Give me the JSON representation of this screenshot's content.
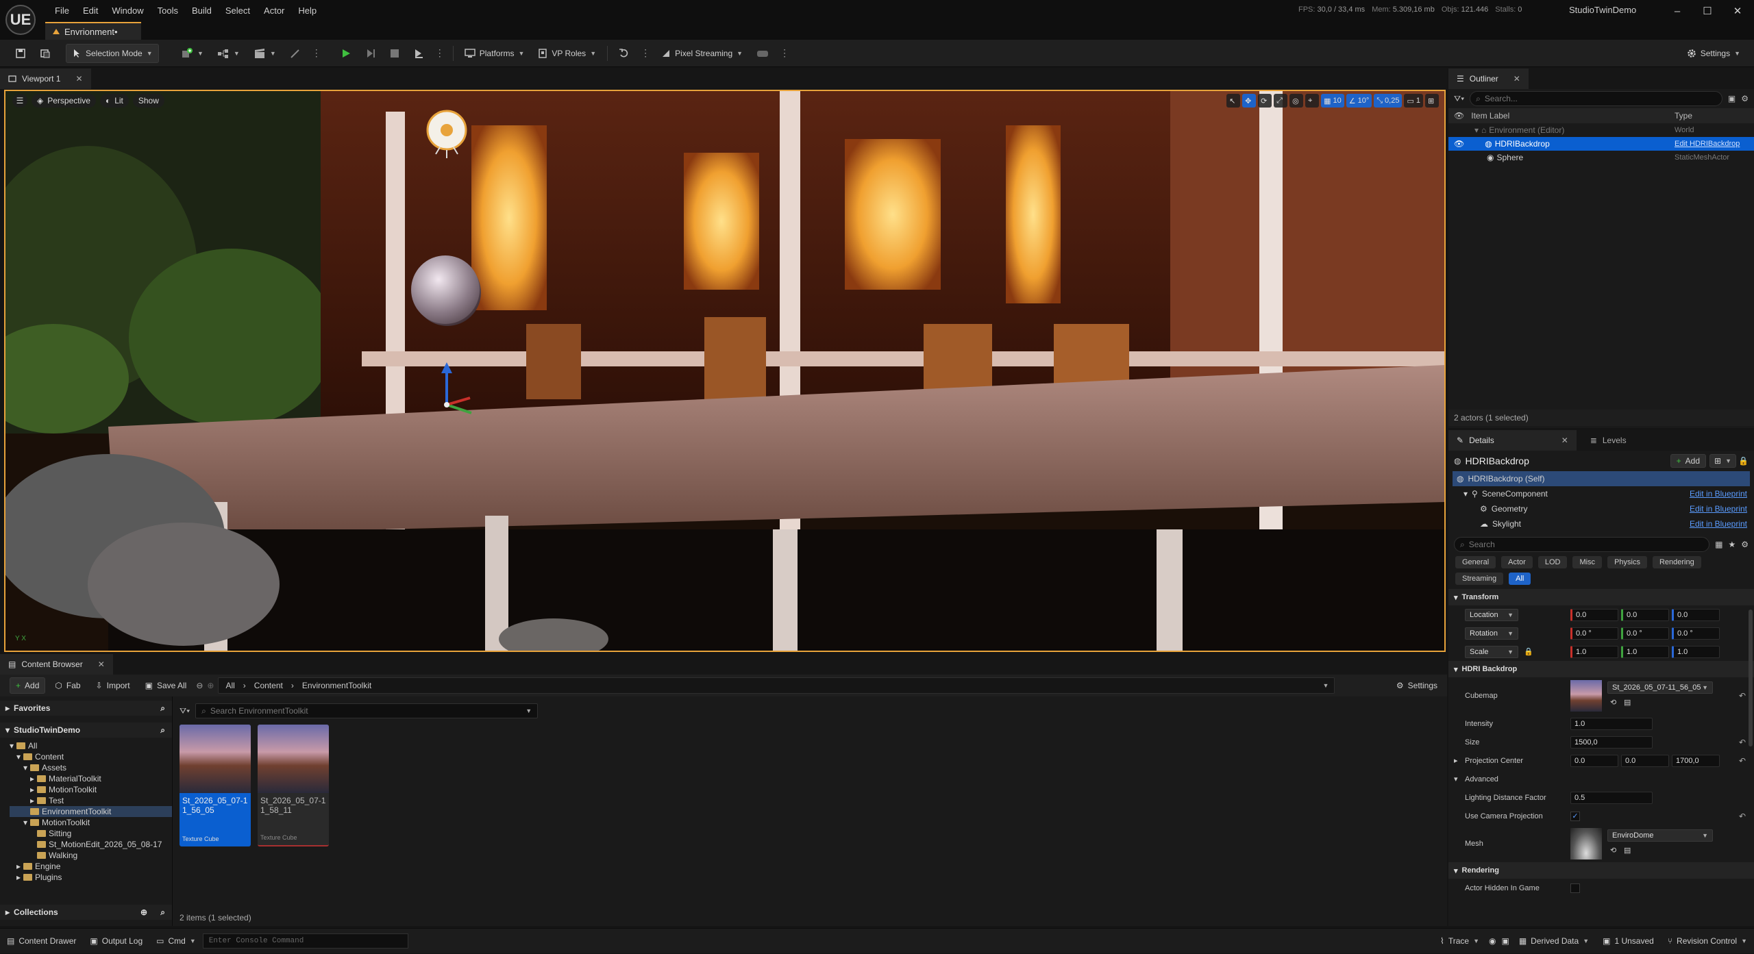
{
  "app": {
    "logo": "UE",
    "menu": [
      "File",
      "Edit",
      "Window",
      "Tools",
      "Build",
      "Select",
      "Actor",
      "Help"
    ],
    "level_tab": "Envrionment•",
    "stats": {
      "fps_label": "FPS:",
      "fps": "30,0",
      "ms": "/ 33,4 ms",
      "mem_label": "Mem:",
      "mem": "5.309,16 mb",
      "objs_label": "Objs:",
      "objs": "121.446",
      "stalls_label": "Stalls:",
      "stalls": "0"
    },
    "project_name": "StudioTwinDemo",
    "window_buttons": {
      "minimize": "–",
      "maximize": "☐",
      "close": "✕"
    }
  },
  "toolbar": {
    "selection_mode": "Selection Mode",
    "platforms": "Platforms",
    "vp_roles": "VP Roles",
    "pixel_streaming": "Pixel Streaming",
    "settings": "Settings"
  },
  "viewport": {
    "tab_label": "Viewport 1",
    "perspective": "Perspective",
    "lit": "Lit",
    "show": "Show",
    "grid_snap": "10",
    "rot_snap": "10°",
    "scale_snap": "0,25",
    "camera_speed": "1",
    "axis_label": "Y X"
  },
  "outliner": {
    "tab_label": "Outliner",
    "search_placeholder": "Search...",
    "col_label": "Item Label",
    "col_type": "Type",
    "rows": [
      {
        "label": "Environment (Editor)",
        "type": "World"
      },
      {
        "label": "HDRIBackdrop",
        "type": "Edit HDRIBackdrop"
      },
      {
        "label": "Sphere",
        "type": "StaticMeshActor"
      }
    ],
    "footer": "2 actors (1 selected)"
  },
  "details": {
    "tab_label": "Details",
    "levels_label": "Levels",
    "actor_name": "HDRIBackdrop",
    "add_label": "Add",
    "components": [
      {
        "label": "HDRIBackdrop (Self)",
        "link": ""
      },
      {
        "label": "SceneComponent",
        "link": "Edit in Blueprint"
      },
      {
        "label": "Geometry",
        "link": "Edit in Blueprint"
      },
      {
        "label": "Skylight",
        "link": "Edit in Blueprint"
      }
    ],
    "search_placeholder": "Search",
    "filters": [
      "General",
      "Actor",
      "LOD",
      "Misc",
      "Physics",
      "Rendering",
      "Streaming",
      "All"
    ],
    "transform": {
      "header": "Transform",
      "location_label": "Location",
      "location": [
        "0.0",
        "0.0",
        "0.0"
      ],
      "rotation_label": "Rotation",
      "rotation": [
        "0.0 °",
        "0.0 °",
        "0.0 °"
      ],
      "scale_label": "Scale",
      "scale": [
        "1.0",
        "1.0",
        "1.0"
      ]
    },
    "hdri": {
      "header": "HDRI Backdrop",
      "cubemap_label": "Cubemap",
      "cubemap_value": "St_2026_05_07-11_56_05",
      "intensity_label": "Intensity",
      "intensity": "1.0",
      "size_label": "Size",
      "size": "1500,0",
      "projection_label": "Projection Center",
      "projection": [
        "0.0",
        "0.0",
        "1700,0"
      ],
      "advanced_label": "Advanced",
      "lighting_label": "Lighting Distance Factor",
      "lighting": "0.5",
      "camera_proj_label": "Use Camera Projection",
      "mesh_label": "Mesh",
      "mesh_value": "EnviroDome"
    },
    "rendering": {
      "header": "Rendering",
      "hidden_label": "Actor Hidden In Game"
    }
  },
  "content_browser": {
    "tab_label": "Content Browser",
    "add": "Add",
    "fab": "Fab",
    "import": "Import",
    "save_all": "Save All",
    "breadcrumb": [
      "All",
      "Content",
      "EnvironmentToolkit"
    ],
    "settings": "Settings",
    "search_placeholder": "Search EnvironmentToolkit",
    "favorites": "Favorites",
    "project": "StudioTwinDemo",
    "collections": "Collections",
    "tree": [
      {
        "label": "All",
        "indent": 0
      },
      {
        "label": "Content",
        "indent": 1
      },
      {
        "label": "Assets",
        "indent": 2
      },
      {
        "label": "MaterialToolkit",
        "indent": 3
      },
      {
        "label": "MotionToolkit",
        "indent": 3
      },
      {
        "label": "Test",
        "indent": 3
      },
      {
        "label": "EnvironmentToolkit",
        "indent": 2
      },
      {
        "label": "MotionToolkit",
        "indent": 2
      },
      {
        "label": "Sitting",
        "indent": 3
      },
      {
        "label": "St_MotionEdit_2026_05_08-17",
        "indent": 3
      },
      {
        "label": "Walking",
        "indent": 3
      },
      {
        "label": "Engine",
        "indent": 1
      },
      {
        "label": "Plugins",
        "indent": 1
      }
    ],
    "assets": [
      {
        "name": "St_2026_05_07-11_56_05",
        "type": "Texture Cube"
      },
      {
        "name": "St_2026_05_07-11_58_11",
        "type": "Texture Cube"
      }
    ],
    "footer": "2 items (1 selected)"
  },
  "statusbar": {
    "content_drawer": "Content Drawer",
    "output_log": "Output Log",
    "cmd": "Cmd",
    "console_placeholder": "Enter Console Command",
    "trace": "Trace",
    "derived_data": "Derived Data",
    "unsaved": "1 Unsaved",
    "revision": "Revision Control"
  },
  "colors": {
    "accent": "#e8a33b",
    "selection": "#0a5fd0",
    "link": "#5a9cff",
    "play": "#3fbf3f"
  }
}
